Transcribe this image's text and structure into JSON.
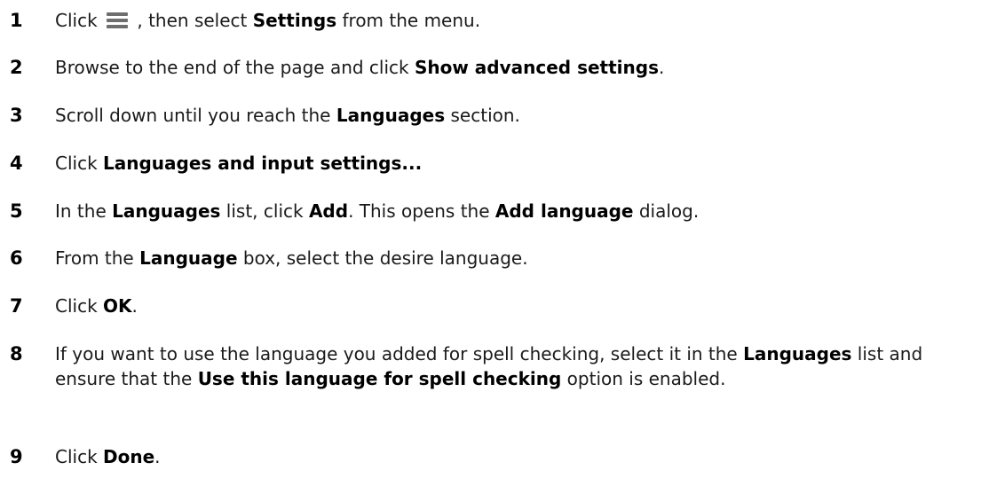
{
  "steps": [
    {
      "number": "1",
      "parts": {
        "a": "Click ",
        "b": " , then select ",
        "c": "Settings",
        "d": " from the menu."
      }
    },
    {
      "number": "2",
      "parts": {
        "a": "Browse to the end of the page and click ",
        "b": "Show advanced settings",
        "c": "."
      }
    },
    {
      "number": "3",
      "parts": {
        "a": "Scroll down until you reach the ",
        "b": "Languages",
        "c": " section."
      }
    },
    {
      "number": "4",
      "parts": {
        "a": "Click ",
        "b": "Languages and input settings..."
      }
    },
    {
      "number": "5",
      "parts": {
        "a": "In the ",
        "b": "Languages",
        "c": " list, click ",
        "d": "Add",
        "e": ". This opens the ",
        "f": "Add language",
        "g": " dialog."
      }
    },
    {
      "number": "6",
      "parts": {
        "a": "From the ",
        "b": "Language",
        "c": " box, select the desire language."
      }
    },
    {
      "number": "7",
      "parts": {
        "a": "Click ",
        "b": "OK",
        "c": "."
      }
    },
    {
      "number": "8",
      "parts": {
        "a": "If you want to use the language you added for spell checking, select it in the ",
        "b": "Languages",
        "c": " list and ensure that the ",
        "d": "Use this language for spell checking",
        "e": " option is enabled."
      }
    },
    {
      "number": "9",
      "parts": {
        "a": "Click ",
        "b": "Done",
        "c": "."
      }
    }
  ],
  "icons": {
    "menu_icon": "menu-icon",
    "menu_icon_color": "#6e6e6e"
  }
}
